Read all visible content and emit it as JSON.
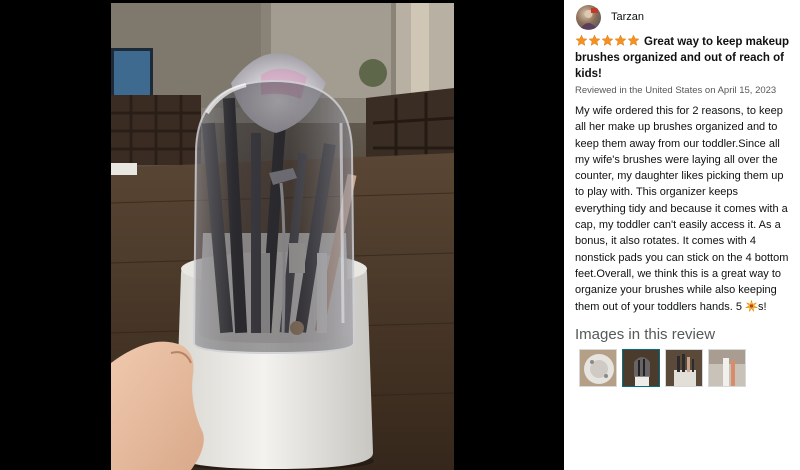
{
  "reviewer": {
    "name": "Tarzan",
    "avatar_icon": "user-avatar-icon"
  },
  "review": {
    "rating": 5,
    "max_rating": 5,
    "star_color": "#f59120",
    "title_line1": "Great way to keep makeup",
    "title_line2": "brushes organized and out of reach of",
    "title_line3": "kids!",
    "meta": "Reviewed in the United States on April 15, 2023",
    "body_lines": [
      "My wife ordered this for 2 reasons, to keep",
      "all her make up brushes organized and to",
      "keep them away from our toddler.Since all",
      "my wife's brushes were laying all over the",
      "counter, my daughter likes picking them up",
      "to play with. This organizer keeps",
      "everything tidy and because it comes with a",
      "cap, my toddler can't easily access it. As a",
      "bonus, it also rotates. It comes with 4",
      "nonstick pads you can stick on the 4 bottom",
      "feet.Overall, we think this is a great way to",
      "organize your brushes while also keeping"
    ],
    "last_line_prefix": "them out of your toddlers hands. 5 ",
    "last_line_suffix": "s!",
    "last_line_icon": "sparkle-star-emoji-icon"
  },
  "images_section": {
    "heading": "Images in this review",
    "thumbnails": [
      "thumbnail-1",
      "thumbnail-2",
      "thumbnail-3",
      "thumbnail-4"
    ]
  },
  "viewer": {
    "selected_image": "thumbnail-2"
  }
}
